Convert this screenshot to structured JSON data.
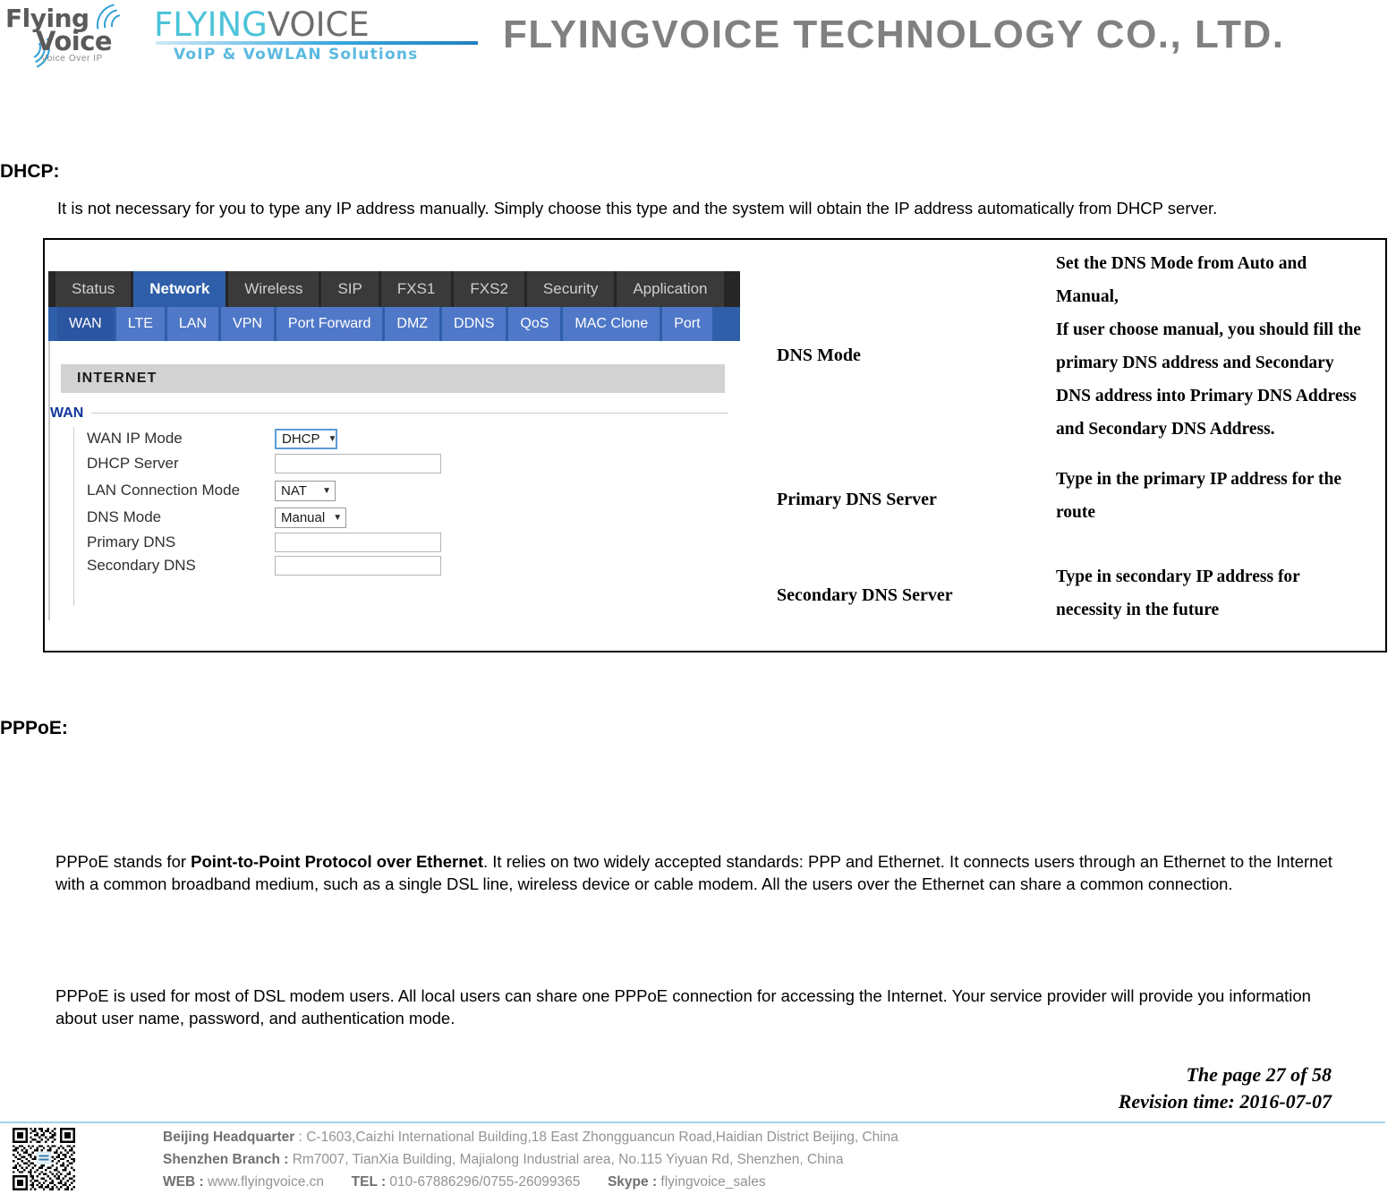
{
  "header": {
    "logo_mark": {
      "word1": "Flying",
      "word2": "Voice",
      "tagline": "Voice Over IP"
    },
    "logo_wordmark": {
      "part_flying": "FLYING",
      "part_voice": "VOICE",
      "subtitle": "VoIP & VoWLAN Solutions"
    },
    "company_title": "FLYINGVOICE TECHNOLOGY CO., LTD."
  },
  "sections": {
    "dhcp": {
      "heading": "DHCP:",
      "paragraph": "It is not necessary for you to type any IP address manually. Simply choose this type and the system will obtain the IP address automatically from DHCP server."
    },
    "pppoe": {
      "heading": "PPPoE:",
      "paragraph1_before": "PPPoE stands for ",
      "paragraph1_bold": "Point-to-Point Protocol over Ethernet",
      "paragraph1_after": ". It relies on two widely accepted standards: PPP and Ethernet. It connects users through an Ethernet to the Internet with a common broadband medium, such as a single DSL line, wireless device or cable modem. All the users over the Ethernet can share a common connection.",
      "paragraph2": "PPPoE is used for most of DSL modem users. All local users can share one PPPoE connection for accessing the Internet. Your service provider will provide you information about user name, password, and authentication mode."
    }
  },
  "router_ui": {
    "main_tabs": [
      {
        "label": "Status",
        "active": false
      },
      {
        "label": "Network",
        "active": true
      },
      {
        "label": "Wireless",
        "active": false
      },
      {
        "label": "SIP",
        "active": false
      },
      {
        "label": "FXS1",
        "active": false
      },
      {
        "label": "FXS2",
        "active": false
      },
      {
        "label": "Security",
        "active": false
      },
      {
        "label": "Application",
        "active": false
      }
    ],
    "sub_tabs": [
      {
        "label": "WAN",
        "active": true
      },
      {
        "label": "LTE",
        "active": false
      },
      {
        "label": "LAN",
        "active": false
      },
      {
        "label": "VPN",
        "active": false
      },
      {
        "label": "Port Forward",
        "active": false
      },
      {
        "label": "DMZ",
        "active": false
      },
      {
        "label": "DDNS",
        "active": false
      },
      {
        "label": "QoS",
        "active": false
      },
      {
        "label": "MAC Clone",
        "active": false
      },
      {
        "label": "Port",
        "active": false
      }
    ],
    "panel_title": "INTERNET",
    "group_label": "WAN",
    "fields": [
      {
        "label": "WAN IP Mode",
        "type": "select",
        "value": "DHCP",
        "focused": true
      },
      {
        "label": "DHCP Server",
        "type": "input",
        "value": "",
        "focused": false
      },
      {
        "label": "LAN Connection Mode",
        "type": "select",
        "value": "NAT",
        "focused": false
      },
      {
        "label": "DNS Mode",
        "type": "select",
        "value": "Manual",
        "focused": false
      },
      {
        "label": "Primary DNS",
        "type": "input",
        "value": "",
        "focused": false
      },
      {
        "label": "Secondary DNS",
        "type": "input",
        "value": "",
        "focused": false
      }
    ]
  },
  "spec_table": {
    "rows": [
      {
        "term": "DNS Mode",
        "description": "Set the DNS Mode from Auto and Manual,\nIf user choose manual, you should fill the primary DNS address and Secondary DNS address into Primary DNS Address and Secondary DNS Address."
      },
      {
        "term": "Primary DNS Server",
        "description": "Type in the primary IP address for the route"
      },
      {
        "term": "Secondary DNS Server",
        "description": "Type in secondary IP address for necessity in the future"
      }
    ],
    "desc_lines_row1": [
      "Set the DNS Mode from Auto and",
      "Manual,",
      "If user choose manual, you should fill the",
      "primary DNS address and Secondary",
      "DNS address into Primary DNS Address",
      "and Secondary DNS Address."
    ],
    "desc_lines_row2": [
      "Type in the primary IP address for the",
      "route"
    ],
    "desc_lines_row3": [
      "Type in secondary IP address for",
      "necessity in the future"
    ]
  },
  "page_meta": {
    "page_line": "The page 27 of 58",
    "revision_line": "Revision time: 2016-07-07"
  },
  "footer": {
    "line1_label": "Beijing Headquarter",
    "line1_value": " :  C-1603,Caizhi International Building,18 East Zhongguancun Road,Haidian District Beijing, China",
    "line2_label": "Shenzhen Branch :",
    "line2_value": " Rm7007, TianXia Building, Majialong Industrial area, No.115 Yiyuan Rd, Shenzhen, China",
    "line3_web_label": "WEB :",
    "line3_web_value": " www.flyingvoice.cn",
    "line3_tel_label": "TEL :",
    "line3_tel_value": " 010-67886296/0755-26099365",
    "line3_skype_label": "Skype :",
    "line3_skype_value": " flyingvoice_sales"
  },
  "colors": {
    "nav_active": "#2e5fa8",
    "nav_bar": "#262626",
    "subnav": "#5078c8",
    "brand_cyan": "#4cc3d9",
    "brand_grey": "#6e6e6e",
    "footer_rule": "#9fd3ea"
  }
}
